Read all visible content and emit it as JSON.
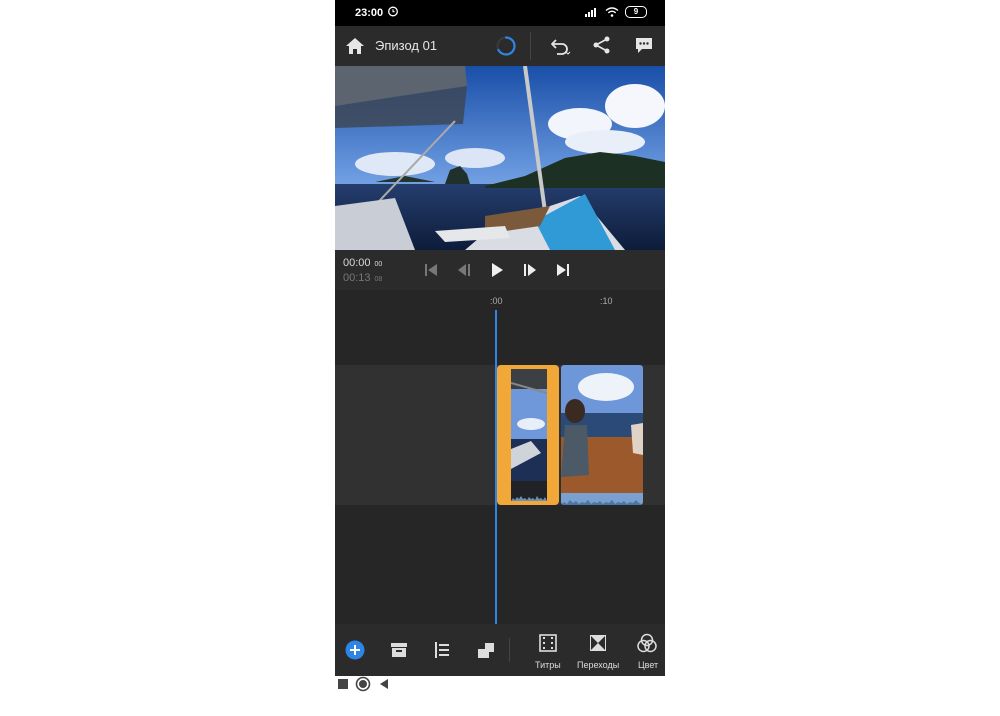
{
  "status_bar": {
    "time": "23:00",
    "battery": "9"
  },
  "app_bar": {
    "title": "Эпизод 01"
  },
  "transport": {
    "current_time": "00:00",
    "current_frames": "00",
    "total_time": "00:13",
    "total_frames": "08"
  },
  "ruler": {
    "tick_start": ":00",
    "tick_10": ":10"
  },
  "toolbar": {
    "titles_label": "Титры",
    "transitions_label": "Переходы",
    "color_label": "Цвет"
  },
  "colors": {
    "accent": "#2d86e5",
    "clip_selected": "#f2a838",
    "background": "#262626"
  }
}
